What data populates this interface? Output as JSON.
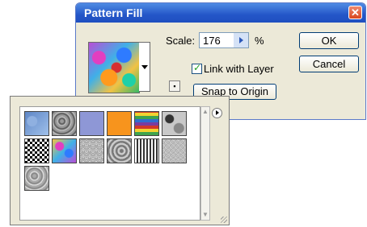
{
  "dialog": {
    "title": "Pattern Fill",
    "close_icon": "close-icon",
    "scale_label": "Scale:",
    "scale_value": "176",
    "scale_unit": "%",
    "link_checkbox_label": "Link with Layer",
    "link_checked": true,
    "snap_button": "Snap to Origin",
    "ok_button": "OK",
    "cancel_button": "Cancel",
    "new_preset_icon": "new-preset-icon"
  },
  "picker": {
    "menu_icon": "flyout-menu-icon",
    "patterns": [
      "blue-stone",
      "gray-gravel",
      "lavender",
      "orange",
      "rainbow-stripes",
      "camouflage",
      "checkerboard",
      "color-swirl",
      "gray-noise",
      "gray-stipple",
      "woven",
      "gray-texture",
      "gray-marble"
    ]
  }
}
